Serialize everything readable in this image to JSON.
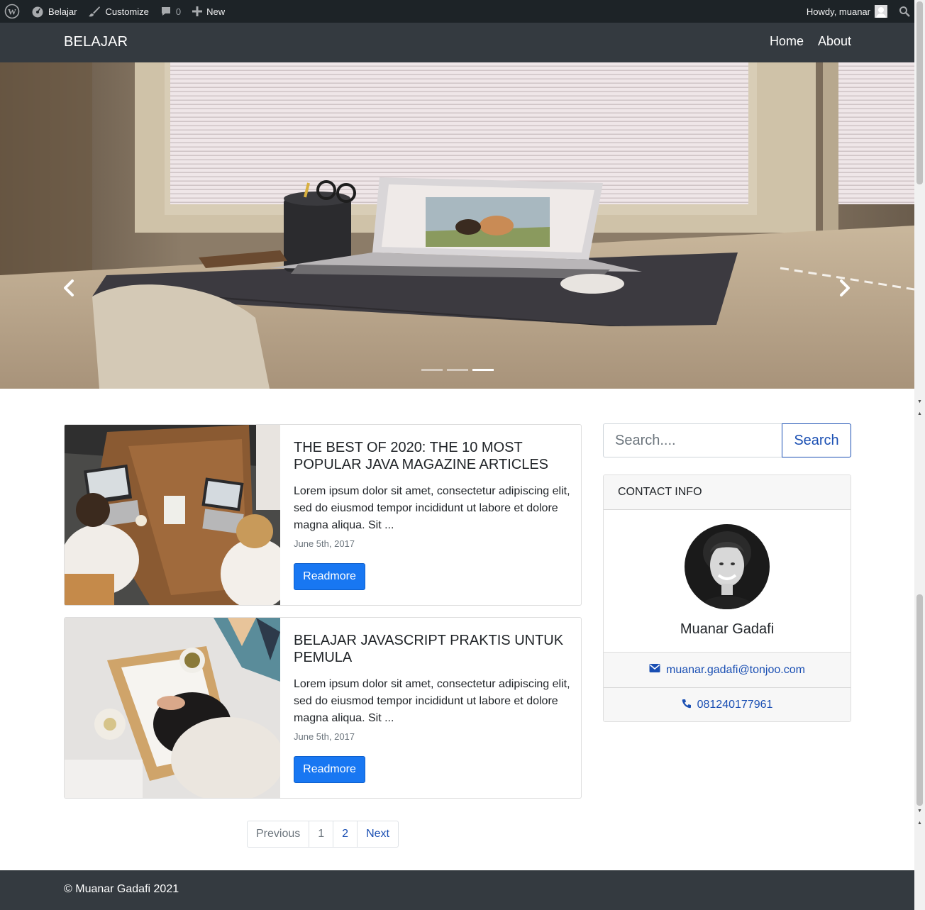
{
  "admin_bar": {
    "site_name": "Belajar",
    "customize": "Customize",
    "comments_count": "0",
    "new_label": "New",
    "howdy": "Howdy, muanar"
  },
  "navbar": {
    "brand": "BELAJAR",
    "links": [
      "Home",
      "About"
    ]
  },
  "carousel": {
    "slide_count": 3,
    "active_index": 2,
    "image": "laptop on desk by window"
  },
  "posts": [
    {
      "title": "THE BEST OF 2020: THE 10 MOST POPULAR JAVA MAGAZINE ARTICLES",
      "excerpt": "Lorem ipsum dolor sit amet, consectetur adipiscing elit, sed do eiusmod tempor incididunt ut labore et dolore magna aliqua. Sit ...",
      "date": "June 5th, 2017",
      "button": "Readmore",
      "image": "two women working on laptops at wooden table"
    },
    {
      "title": "BELAJAR JAVASCRIPT PRAKTIS UNTUK PEMULA",
      "excerpt": "Lorem ipsum dolor sit amet, consectetur adipiscing elit, sed do eiusmod tempor incididunt ut labore et dolore magna aliqua. Sit ...",
      "date": "June 5th, 2017",
      "button": "Readmore",
      "image": "woman writing on notebook in bed"
    }
  ],
  "pagination": {
    "previous": "Previous",
    "pages": [
      "1",
      "2"
    ],
    "next": "Next",
    "current": "1"
  },
  "sidebar": {
    "search": {
      "placeholder": "Search....",
      "button": "Search"
    },
    "contact": {
      "heading": "CONTACT INFO",
      "name": "Muanar Gadafi",
      "email": "muanar.gadafi@tonjoo.com",
      "phone": "081240177961"
    }
  },
  "footer": {
    "copyright": "© Muanar Gadafi 2021"
  },
  "colors": {
    "admin_bar": "#1d2327",
    "navbar": "#343a40",
    "primary": "#1877f2",
    "link": "#1a4fb3"
  }
}
